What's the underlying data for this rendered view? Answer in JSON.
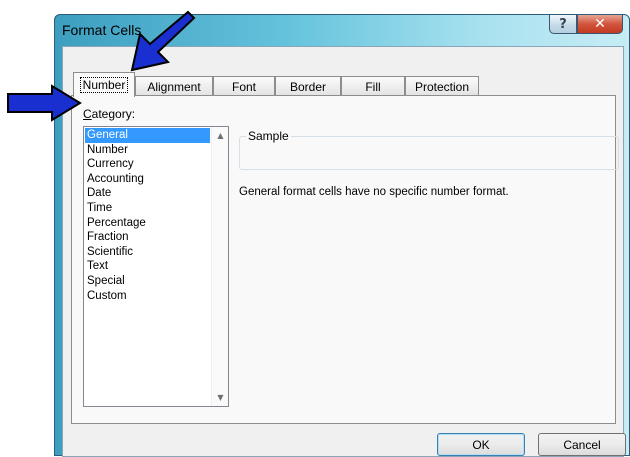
{
  "window": {
    "title": "Format Cells",
    "help_glyph": "?",
    "close_glyph": "✕"
  },
  "tabs": [
    {
      "label": "Number",
      "active": true
    },
    {
      "label": "Alignment",
      "active": false
    },
    {
      "label": "Font",
      "active": false
    },
    {
      "label": "Border",
      "active": false
    },
    {
      "label": "Fill",
      "active": false
    },
    {
      "label": "Protection",
      "active": false
    }
  ],
  "category": {
    "label_mnemonic": "C",
    "label_rest": "ategory:",
    "items": [
      "General",
      "Number",
      "Currency",
      "Accounting",
      "Date",
      "Time",
      "Percentage",
      "Fraction",
      "Scientific",
      "Text",
      "Special",
      "Custom"
    ],
    "selected": "General"
  },
  "sample": {
    "legend": "Sample",
    "value": ""
  },
  "description": "General format cells have no specific number format.",
  "buttons": {
    "ok": "OK",
    "cancel": "Cancel"
  },
  "icons": {
    "scroll_up": "scroll-up-arrow-icon",
    "scroll_down": "scroll-down-arrow-icon",
    "annotation_arrows": "blue-arrow-icon"
  },
  "colors": {
    "selection": "#3399ff",
    "annotation_arrow": "#1a2fcf",
    "close_button": "#c7432a"
  }
}
